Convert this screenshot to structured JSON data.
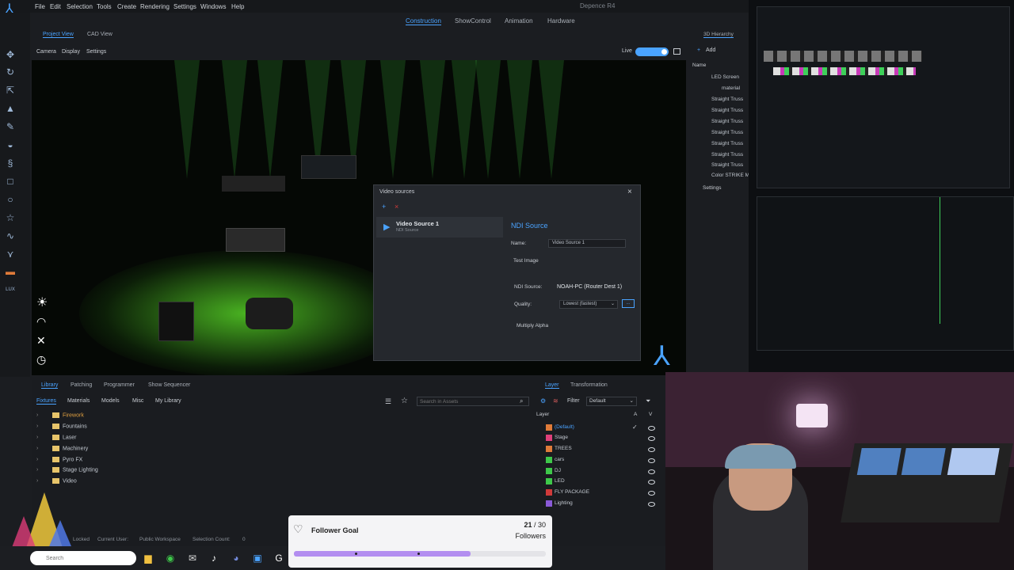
{
  "menu": {
    "items": [
      "File",
      "Edit",
      "Selection",
      "Tools",
      "Create",
      "Rendering",
      "Settings",
      "Windows",
      "Help"
    ],
    "app_title": "Depence R4"
  },
  "modes": [
    "Construction",
    "ShowControl",
    "Animation",
    "Hardware"
  ],
  "view_tabs": [
    "Project View",
    "CAD View"
  ],
  "view_menu": [
    "Camera",
    "Display",
    "Settings"
  ],
  "live_label": "Live",
  "hierarchy": {
    "tab": "3D Hierarchy",
    "add_label": "Add",
    "name_header": "Name",
    "items": [
      "LED Screen",
      "material",
      "Straight Truss",
      "Straight Truss",
      "Straight Truss",
      "Straight Truss",
      "Straight Truss",
      "Straight Truss",
      "Straight Truss",
      "Color STRIKE M"
    ],
    "settings": "Settings"
  },
  "dialog": {
    "title": "Video sources",
    "source_name": "Video Source 1",
    "source_type": "NDI Source",
    "section_title": "NDI Source",
    "name_label": "Name:",
    "name_value": "Video Source 1",
    "test_image": "Test Image",
    "ndi_label": "NDI Source:",
    "ndi_value": "NOAH-PC (Router Dest 1)",
    "quality_label": "Quality:",
    "quality_value": "Lowest (fastest)",
    "more_button": "...",
    "multiply_alpha": "Multiply Alpha"
  },
  "bottom_tabs": [
    "Library",
    "Patching",
    "Programmer",
    "Show Sequencer"
  ],
  "library": {
    "subtabs": [
      "Fixtures",
      "Materials",
      "Models",
      "Misc",
      "My Library"
    ],
    "search_placeholder": "Search in Assets",
    "folders": [
      "Firework",
      "Fountains",
      "Laser",
      "Machinery",
      "Pyro FX",
      "Stage Lighting",
      "Video"
    ]
  },
  "layer_panel": {
    "tabs": [
      "Layer",
      "Transformation"
    ],
    "filter_label": "Filter",
    "filter_value": "Default",
    "header": "Layer",
    "col_a": "A",
    "col_v": "V",
    "layers": [
      {
        "name": "(Default)",
        "color": "#e07b39"
      },
      {
        "name": "Stage",
        "color": "#e0407a"
      },
      {
        "name": "TREES",
        "color": "#e07b39"
      },
      {
        "name": "cars",
        "color": "#3ec84a"
      },
      {
        "name": "DJ",
        "color": "#3ec84a"
      },
      {
        "name": "LED",
        "color": "#3ec84a"
      },
      {
        "name": "FLY PACKAGE",
        "color": "#d03a3a"
      },
      {
        "name": "Lighting",
        "color": "#8a5ad8"
      }
    ]
  },
  "status_bar": [
    "Locked",
    "Current User:",
    "Public Workspace",
    "Selection Count:",
    "0"
  ],
  "search_placeholder": "Search",
  "follower_goal": {
    "title": "Follower Goal",
    "current": "21",
    "separator": " / ",
    "target": "30",
    "unit": "Followers",
    "progress": 0.7
  },
  "colors": {
    "accent": "#4aa3ff",
    "goal_bar": "#b38ef0"
  }
}
